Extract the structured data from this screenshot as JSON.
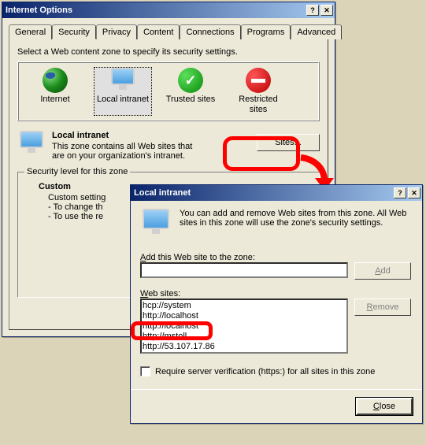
{
  "window1": {
    "title": "Internet Options",
    "tabs": [
      "General",
      "Security",
      "Privacy",
      "Content",
      "Connections",
      "Programs",
      "Advanced"
    ],
    "active_tab": 1,
    "instruction": "Select a Web content zone to specify its security settings.",
    "zones": [
      {
        "name": "internet",
        "label": "Internet"
      },
      {
        "name": "local-intranet",
        "label": "Local intranet"
      },
      {
        "name": "trusted-sites",
        "label": "Trusted sites"
      },
      {
        "name": "restricted-sites",
        "label": "Restricted sites"
      }
    ],
    "zone_title": "Local intranet",
    "zone_desc": "This zone contains all Web sites that are on your organization's intranet.",
    "sites_btn": "Sites...",
    "fieldset_legend": "Security level for this zone",
    "custom_title": "Custom",
    "custom_sub": "Custom setting",
    "custom_line1": "- To change th",
    "custom_line2": "- To use the re"
  },
  "window2": {
    "title": "Local intranet",
    "message": "You can add and remove Web sites from this zone. All Web sites in this zone will use the zone's security settings.",
    "add_label_pre": "A",
    "add_label_rest": "dd this Web site to the zone:",
    "add_btn": "Add",
    "sites_label_pre": "W",
    "sites_label_rest": "eb sites:",
    "remove_btn": "Remove",
    "sites": [
      "hcp://system",
      "http://localhost",
      "http://localhost",
      "http://mstoll",
      "http://53.107.17.86"
    ],
    "checkbox_label": "Require server verification (https:) for all sites in this zone",
    "close_btn": "Close"
  }
}
